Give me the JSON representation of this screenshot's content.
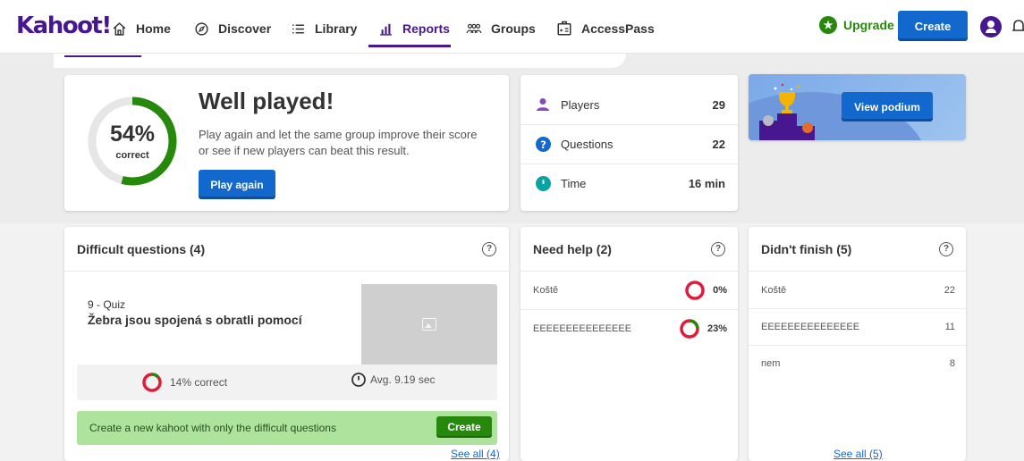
{
  "nav": {
    "logo": "Kahoot!",
    "items": [
      {
        "label": "Home",
        "icon": "home-icon"
      },
      {
        "label": "Discover",
        "icon": "compass-icon"
      },
      {
        "label": "Library",
        "icon": "list-icon"
      },
      {
        "label": "Reports",
        "icon": "bar-chart-icon",
        "active": true
      },
      {
        "label": "Groups",
        "icon": "group-icon"
      },
      {
        "label": "AccessPass",
        "icon": "accesspass-icon"
      }
    ],
    "upgrade_label": "Upgrade",
    "create_label": "Create"
  },
  "summary": {
    "percent": "54%",
    "percent_value": 0.54,
    "percent_sub": "correct",
    "title": "Well played!",
    "description": "Play again and let the same group improve their score or see if new players can beat this result.",
    "play_again_label": "Play again"
  },
  "stats": [
    {
      "label": "Players",
      "value": "29",
      "icon": "player-icon"
    },
    {
      "label": "Questions",
      "value": "22",
      "icon": "question-icon"
    },
    {
      "label": "Time",
      "value": "16 min",
      "icon": "clock-icon"
    }
  ],
  "podium": {
    "button_label": "View podium"
  },
  "difficult": {
    "title": "Difficult questions (4)",
    "quiz_type": "9 - Quiz",
    "question": "Žebra jsou spojená s obratli pomocí",
    "correct_text": "14% correct",
    "correct_value": 0.14,
    "avg_text": "Avg. 9.19 sec",
    "create_text": "Create a new kahoot with only the difficult questions",
    "create_label": "Create",
    "see_all": "See all (4)"
  },
  "need_help": {
    "title": "Need help (2)",
    "rows": [
      {
        "name": "Koště",
        "value": "0%",
        "fraction": 0.0
      },
      {
        "name": "EEEEEEEEEEEEEEE",
        "value": "23%",
        "fraction": 0.23
      }
    ]
  },
  "didnt_finish": {
    "title": "Didn't finish (5)",
    "rows": [
      {
        "name": "Koště",
        "value": "22"
      },
      {
        "name": "EEEEEEEEEEEEEEE",
        "value": "11"
      },
      {
        "name": "nem",
        "value": "8"
      }
    ],
    "see_all": "See all (5)"
  },
  "colors": {
    "brand": "#46178f",
    "primary": "#1368ce",
    "success": "#26890c",
    "danger": "#e21b3c"
  }
}
